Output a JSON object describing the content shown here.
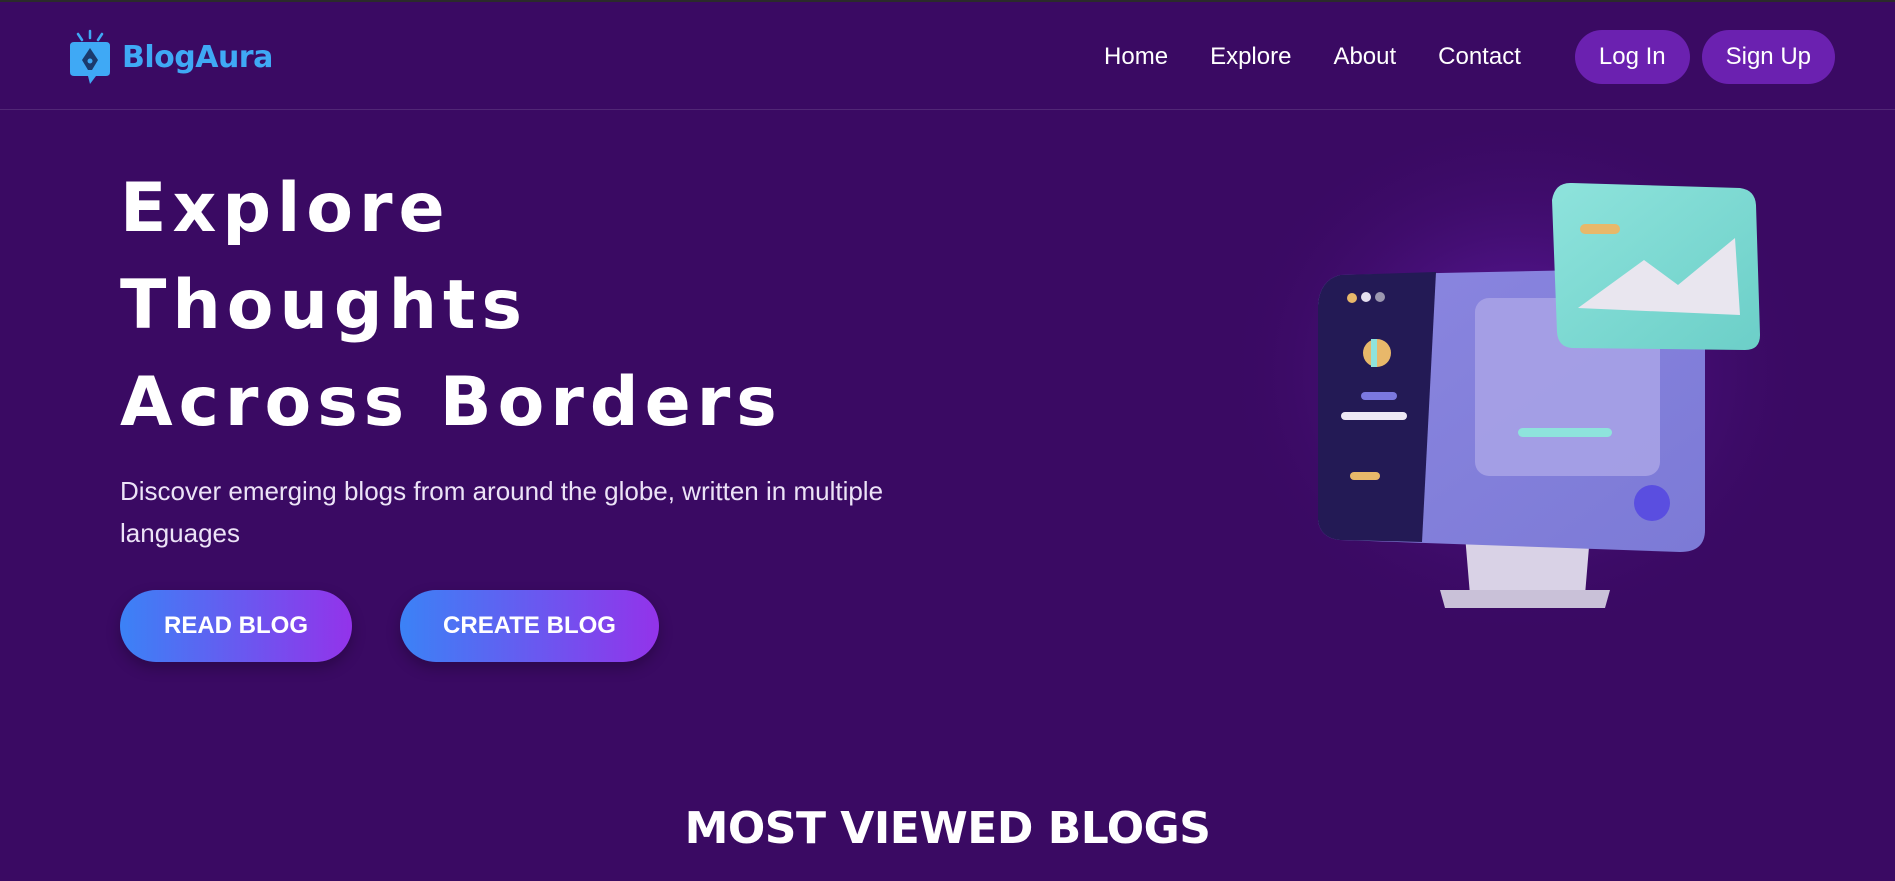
{
  "brand": {
    "name": "BlogAura",
    "logo_icon": "pen-nib-chat-icon",
    "color": "#3fa9f5"
  },
  "nav": {
    "links": [
      "Home",
      "Explore",
      "About",
      "Contact"
    ],
    "login_label": "Log In",
    "signup_label": "Sign Up"
  },
  "hero": {
    "title_lines": [
      "Explore",
      "Thoughts",
      "Across Borders"
    ],
    "subtitle": "Discover emerging blogs from around the globe, written in multiple languages",
    "read_button": "READ BLOG",
    "create_button": "CREATE BLOG",
    "illustration": "monitor-illustration"
  },
  "section": {
    "title": "MOST VIEWED BLOGS"
  },
  "colors": {
    "background": "#3a0a63",
    "nav_button": "#6b21b0",
    "cta_start": "#3b82f6",
    "cta_end": "#9333ea"
  }
}
